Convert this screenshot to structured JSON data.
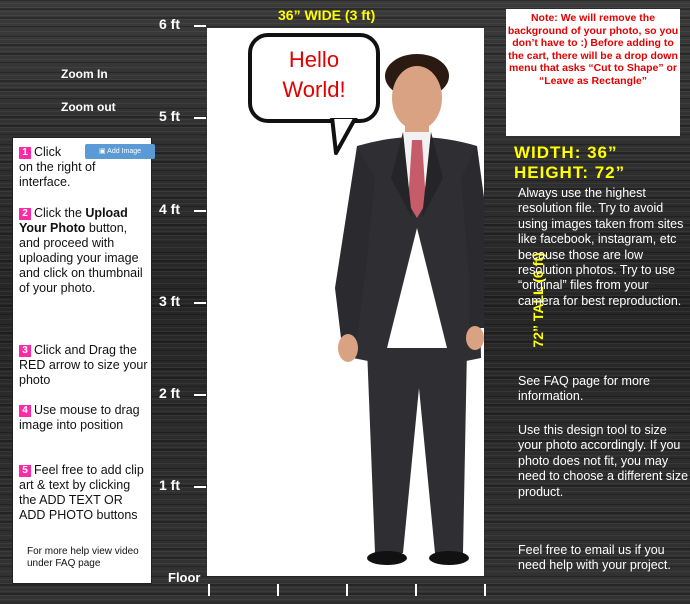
{
  "ruler": {
    "labels": [
      "6 ft",
      "5 ft",
      "4 ft",
      "3 ft",
      "2 ft",
      "1 ft"
    ],
    "floor": "Floor",
    "wide_label": "36” WIDE (3 ft)",
    "tall_label": "72” TALL (6 ft)"
  },
  "zoom": {
    "in": "Zoom In",
    "out": "Zoom out"
  },
  "bubble": {
    "line1": "Hello",
    "line2": "World!"
  },
  "instructions": {
    "add_image_button": "Add Image",
    "steps": [
      {
        "num": "1",
        "pre": "Click",
        "bold": "",
        "post": "on the right of interface."
      },
      {
        "num": "2",
        "pre": "Click the ",
        "bold": "Upload Your Photo",
        "post": " button, and proceed with uploading your image and click on thumbnail of your photo."
      },
      {
        "num": "3",
        "pre": "Click and Drag the RED arrow to size your photo",
        "bold": "",
        "post": ""
      },
      {
        "num": "4",
        "pre": "Use mouse to drag image into position",
        "bold": "",
        "post": ""
      },
      {
        "num": "5",
        "pre": "Feel free to add clip art & text by clicking the ADD TEXT OR ADD PHOTO buttons",
        "bold": "",
        "post": ""
      }
    ],
    "help": "For more help view video under FAQ page"
  },
  "note": "Note: We will remove the background of your photo, so you don’t have to :) Before adding to the cart, there will be a drop down menu that asks “Cut to Shape” or “Leave as Rectangle”",
  "dims": {
    "width": "WIDTH: 36”",
    "height": "HEIGHT: 72”"
  },
  "info": {
    "p1": "Always use the highest resolution file. Try to avoid using images taken from sites like facebook, instagram, etc because those are low resolution photos. Try to use “original” files from your camera for best reproduction.",
    "p2": "See FAQ page for more information.",
    "p3": "Use this design tool to size your photo accordingly.  If you photo does not fit, you may need to choose a different size product.",
    "p4": "Feel free to email us if you need help with your project."
  }
}
